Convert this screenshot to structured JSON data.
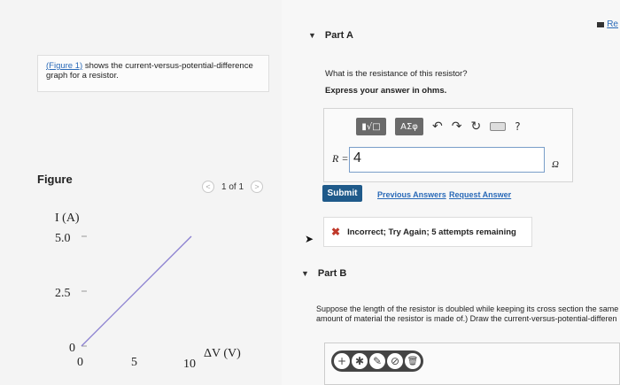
{
  "left": {
    "intro_link": "(Figure 1)",
    "intro_text": " shows the current-versus-potential-difference graph for a resistor.",
    "figure_title": "Figure",
    "pager": {
      "text": "1 of 1",
      "prev": "<",
      "next": ">"
    }
  },
  "graph": {
    "y_label": "I (A)",
    "x_label": "ΔV (V)",
    "y_ticks": [
      "5.0",
      "2.5",
      "0"
    ],
    "x_ticks": [
      "0",
      "5",
      "10"
    ],
    "line_color": "#8a7fd0",
    "chart_data": {
      "type": "line",
      "x": [
        0,
        10
      ],
      "y": [
        0,
        5
      ],
      "xlabel": "ΔV (V)",
      "ylabel": "I (A)",
      "xlim": [
        0,
        10
      ],
      "ylim": [
        0,
        5
      ]
    }
  },
  "right": {
    "re_link": "Re",
    "part_a": "Part A",
    "question": "What is the resistance of this resistor?",
    "instruction": "Express your answer in ohms.",
    "toolbar": {
      "template_btn": "▮√□",
      "greek_btn": "ΑΣφ",
      "undo": "↶",
      "redo": "↷",
      "reset": "↻",
      "help": "?"
    },
    "r_label": "R =",
    "r_value": "4",
    "r_unit": "Ω",
    "submit": "Submit",
    "previous_answers": "Previous Answers",
    "request_answer": "Request Answer",
    "feedback": "Incorrect; Try Again; 5 attempts remaining",
    "part_b": "Part B",
    "part_b_line1": "Suppose the length of the resistor is doubled while keeping its cross section the same",
    "part_b_line2": "amount of material the resistor is made of.) Draw the current-versus-potential-differen",
    "draw_tools": [
      "+",
      "✱",
      "✎",
      "⊘",
      "🗑"
    ]
  },
  "colors": {
    "accent": "#1f5a8a",
    "link": "#2a6ab8",
    "error": "#c0392b"
  }
}
